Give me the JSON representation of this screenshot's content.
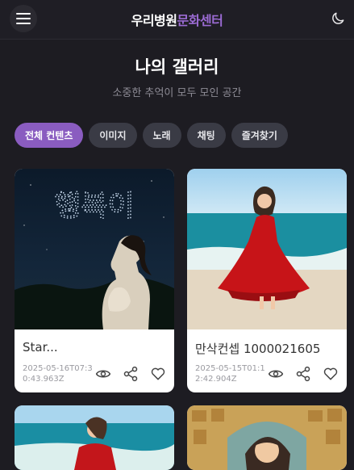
{
  "header": {
    "brand_part1": "우리병원",
    "brand_part2": "문화센터",
    "menu_icon": "hamburger-icon",
    "theme_icon": "moon-icon",
    "accent": "#9b6bd3"
  },
  "page": {
    "title": "나의 갤러리",
    "subtitle": "소중한 추억이 모두 모인 공간"
  },
  "filters": [
    {
      "label": "전체 컨텐츠",
      "active": true
    },
    {
      "label": "이미지",
      "active": false
    },
    {
      "label": "노래",
      "active": false
    },
    {
      "label": "채팅",
      "active": false
    },
    {
      "label": "즐겨찾기",
      "active": false
    }
  ],
  "cards": [
    {
      "image_text": "행복이",
      "title": "Star...",
      "date": "2025-05-16T07:30:43.963Z",
      "actions": [
        "eye-icon",
        "share-icon",
        "heart-icon"
      ]
    },
    {
      "title": "만삭컨셉 1000021605",
      "date": "2025-05-15T01:12:42.904Z",
      "actions": [
        "eye-icon",
        "share-icon",
        "heart-icon"
      ]
    },
    {
      "title": ""
    },
    {
      "title": ""
    }
  ],
  "colors": {
    "background": "#1d1c22",
    "chip_active": "#8a5cc0",
    "chip": "#3a3b45"
  }
}
